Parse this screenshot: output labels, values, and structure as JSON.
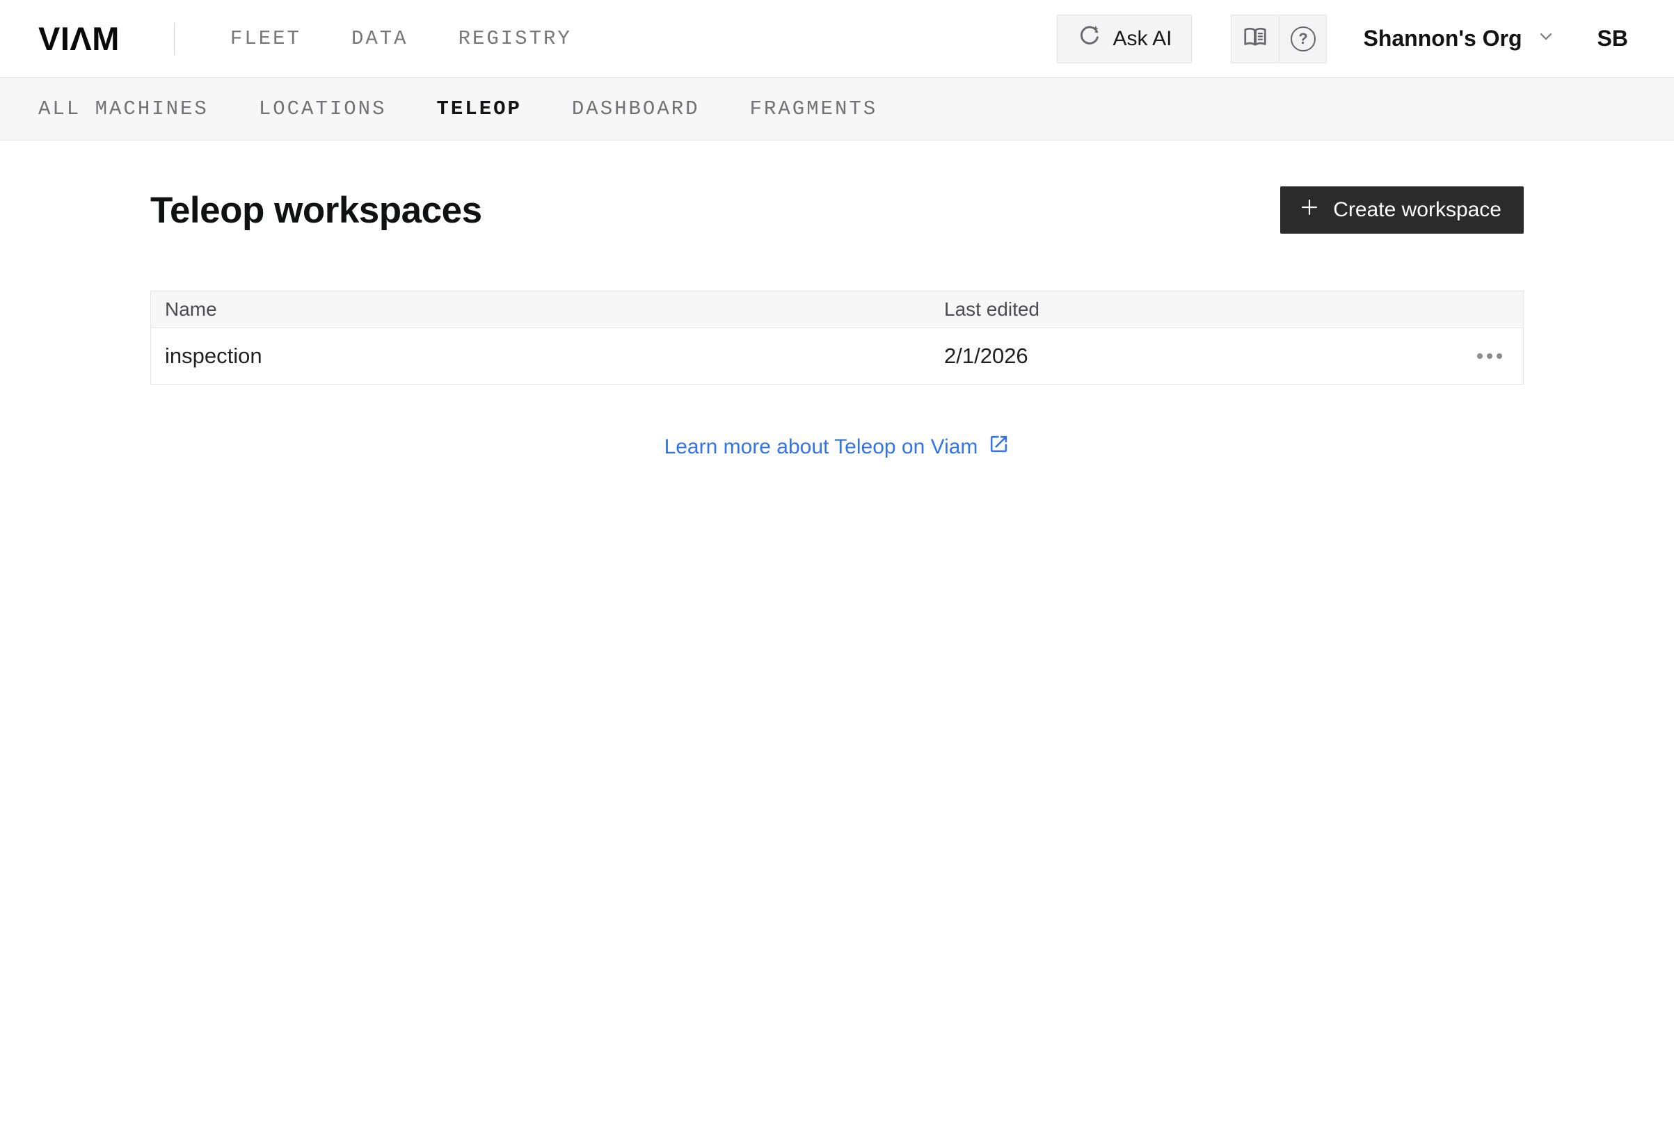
{
  "header": {
    "logo": "VIΛM",
    "nav": [
      {
        "label": "FLEET"
      },
      {
        "label": "DATA"
      },
      {
        "label": "REGISTRY"
      }
    ],
    "ask_ai_label": "Ask AI",
    "org_name": "Shannon's Org",
    "avatar_initials": "SB",
    "icons": {
      "ask_ai": "sparkle-refresh-icon",
      "docs": "open-book-icon",
      "help": "question-circle-icon",
      "help_glyph": "?",
      "org_chevron": "chevron-down-icon"
    }
  },
  "subnav": {
    "items": [
      {
        "label": "ALL MACHINES",
        "active": false
      },
      {
        "label": "LOCATIONS",
        "active": false
      },
      {
        "label": "TELEOP",
        "active": true
      },
      {
        "label": "DASHBOARD",
        "active": false
      },
      {
        "label": "FRAGMENTS",
        "active": false
      }
    ]
  },
  "main": {
    "title": "Teleop workspaces",
    "create_button_label": "Create workspace",
    "table": {
      "columns": [
        "Name",
        "Last edited"
      ],
      "rows": [
        {
          "name": "inspection",
          "last_edited": "2/1/2026"
        }
      ]
    },
    "learn_more_label": "Learn more about Teleop on Viam"
  },
  "colors": {
    "accent_blue": "#3374ec",
    "button_dark": "#2b2b2c",
    "subnav_background": "#f7f7f8",
    "border": "#e5e5e8",
    "muted_text": "#717176"
  }
}
